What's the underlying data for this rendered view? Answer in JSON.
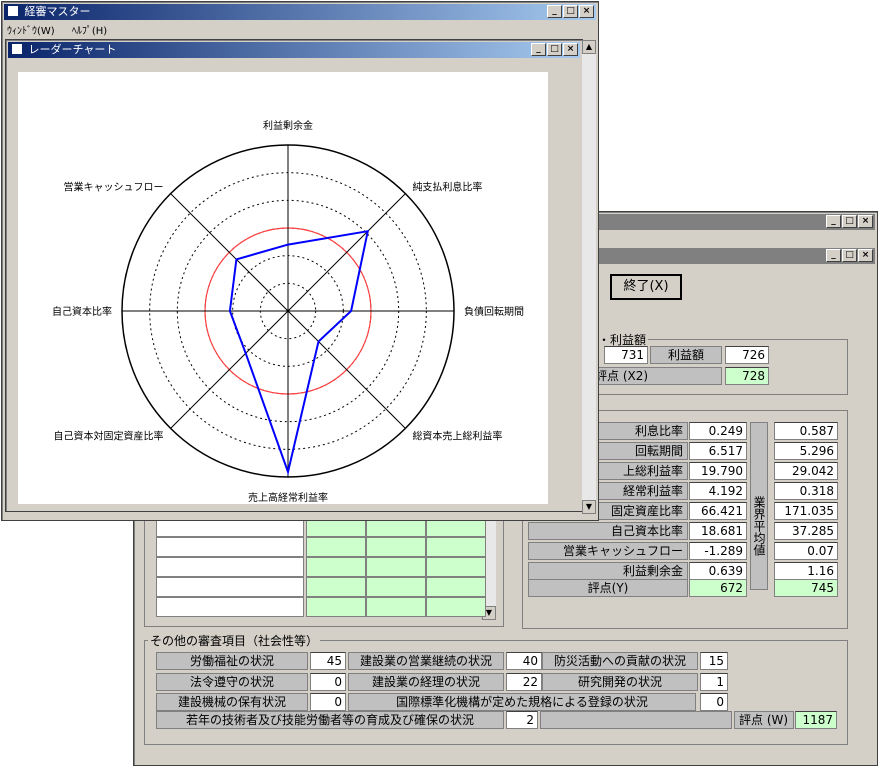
{
  "radar_window": {
    "title": "レーダーチャート",
    "labels": [
      "利益剰余金",
      "純支払利息比率",
      "負債回転期間",
      "総資本売上総利益率",
      "売上高経常利益率",
      "自己資本対固定資産比率",
      "自己資本比率",
      "営業キャッシュフロー"
    ],
    "scores": [
      0.4,
      0.68,
      0.38,
      0.26,
      0.97,
      0.36,
      0.35,
      0.44
    ]
  },
  "main_window": {
    "title": "経審マスター",
    "menu": [
      "ｳｨﾝﾄﾞｳ(W)",
      "ﾍﾙﾌﾟ(H)"
    ]
  },
  "form": {
    "end_button": "終了(X)",
    "profit_group": "・利益額",
    "profit_amount_left": "731",
    "profit_amount_label": "利益額",
    "profit_amount_value": "726",
    "score_x2_label": "評点 (X2)",
    "score_x2_value": "728",
    "ratio_rows": [
      {
        "label": "利息比率",
        "value": "0.249",
        "avg": "0.587"
      },
      {
        "label": "回転期間",
        "value": "6.517",
        "avg": "5.296"
      },
      {
        "label": "上総利益率",
        "value": "19.790",
        "avg": "29.042"
      },
      {
        "label": "経常利益率",
        "value": "4.192",
        "avg": "0.318"
      },
      {
        "label": "固定資産比率",
        "value": "66.421",
        "avg": "171.035"
      },
      {
        "label": "自己資本比率",
        "value": "18.681",
        "avg": "37.285"
      },
      {
        "label": "営業キャッシュフロー",
        "value": "-1.289",
        "avg": "0.07"
      },
      {
        "label": "利益剰余金",
        "value": "0.639",
        "avg": "1.16"
      }
    ],
    "industry_avg_label": "業界平均値",
    "score_y_label": "評点(Y)",
    "score_y_value": "672",
    "score_y_avg": "745",
    "other_group": "その他の審査項目（社会性等）",
    "other_items": [
      {
        "label": "労働福祉の状況",
        "value": "45"
      },
      {
        "label": "建設業の営業継続の状況",
        "value": "40"
      },
      {
        "label": "防災活動への貢献の状況",
        "value": "15"
      },
      {
        "label": "法令遵守の状況",
        "value": "0"
      },
      {
        "label": "建設業の経理の状況",
        "value": "22"
      },
      {
        "label": "研究開発の状況",
        "value": "1"
      },
      {
        "label": "建設機械の保有状況",
        "value": "0"
      },
      {
        "label": "国際標準化機構が定めた規格による登録の状況",
        "value": "0"
      },
      {
        "label": "若年の技術者及び技能労働者等の育成及び確保の状況",
        "value": "2"
      }
    ],
    "score_w_label": "評点 (W)",
    "score_w_value": "1187"
  }
}
